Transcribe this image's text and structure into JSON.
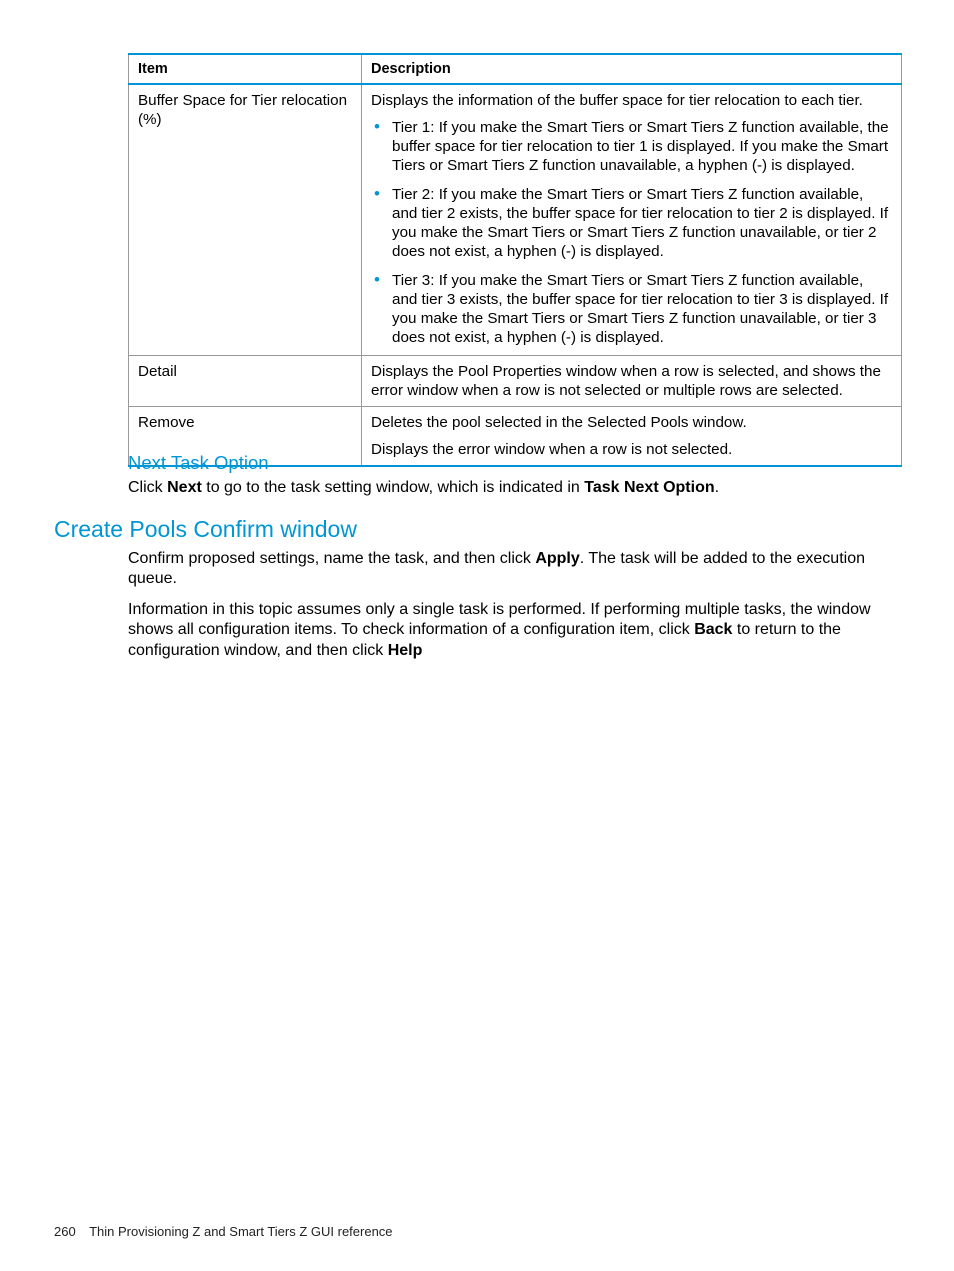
{
  "table": {
    "headers": {
      "item": "Item",
      "description": "Description"
    },
    "rows": [
      {
        "item": "Buffer Space for Tier relocation (%)",
        "desc_intro": "Displays the information of the buffer space for tier relocation to each tier.",
        "bullets": [
          "Tier 1: If you make the Smart Tiers or Smart Tiers Z function available, the buffer space for tier relocation to tier 1 is displayed. If you make the Smart Tiers or Smart Tiers Z function unavailable, a hyphen (-) is displayed.",
          "Tier 2: If you make the Smart Tiers or Smart Tiers Z function available, and tier 2 exists, the buffer space for tier relocation to tier 2 is displayed. If you make the Smart Tiers or Smart Tiers Z function unavailable, or tier 2 does not exist, a hyphen (-) is displayed.",
          "Tier 3: If you make the Smart Tiers or Smart Tiers Z function available, and tier 3 exists, the buffer space for tier relocation to tier 3 is displayed. If you make the Smart Tiers or Smart Tiers Z function unavailable, or tier 3 does not exist, a hyphen (-) is displayed."
        ]
      },
      {
        "item": "Detail",
        "desc": "Displays the Pool Properties window when a row is selected, and shows the error window when a row is not selected or multiple rows are selected."
      },
      {
        "item": "Remove",
        "desc_line1": "Deletes the pool selected in the Selected Pools window.",
        "desc_line2": "Displays the error window when a row is not selected."
      }
    ]
  },
  "next_task": {
    "heading": "Next Task Option",
    "text_prefix": "Click ",
    "text_bold1": "Next",
    "text_mid": " to go to the task setting window, which is indicated in ",
    "text_bold2": "Task Next Option",
    "text_suffix": "."
  },
  "create_pools": {
    "heading": "Create Pools Confirm window",
    "p1_prefix": "Confirm proposed settings, name the task, and then click ",
    "p1_bold": "Apply",
    "p1_suffix": ". The task will be added to the execution queue.",
    "p2_prefix": "Information in this topic assumes only a single task is performed. If performing multiple tasks, the window shows all configuration items. To check information of a configuration item, click ",
    "p2_bold1": "Back",
    "p2_mid": " to return to the configuration window, and then click ",
    "p2_bold2": "Help"
  },
  "footer": {
    "page_number": "260",
    "title": "Thin Provisioning Z and Smart Tiers Z GUI reference"
  }
}
